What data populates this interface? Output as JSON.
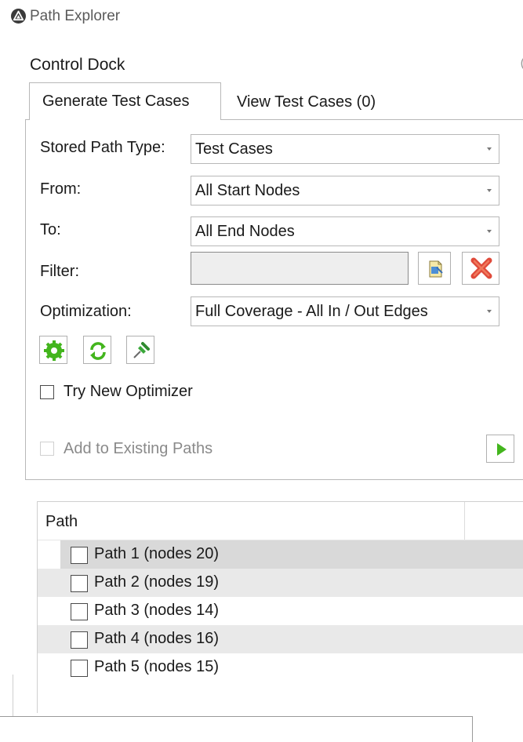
{
  "window": {
    "title": "Path Explorer",
    "icon": "app-logo-icon"
  },
  "dock": {
    "title": "Control Dock"
  },
  "tabs": [
    {
      "label": "Generate Test Cases",
      "active": true
    },
    {
      "label": "View Test Cases (0)",
      "active": false
    }
  ],
  "form": {
    "stored_path_type": {
      "label": "Stored Path Type:",
      "value": "Test Cases"
    },
    "from": {
      "label": "From:",
      "value": "All Start Nodes"
    },
    "to": {
      "label": "To:",
      "value": "All End Nodes"
    },
    "filter": {
      "label": "Filter:",
      "value": ""
    },
    "optimization": {
      "label": "Optimization:",
      "value": "Full Coverage - All In / Out Edges"
    },
    "try_new_optimizer": {
      "label": "Try New Optimizer",
      "checked": false
    },
    "add_to_existing": {
      "label": "Add to Existing Paths",
      "checked": false,
      "enabled": false
    }
  },
  "toolbar": {
    "buttons": [
      {
        "name": "generate-button",
        "icon": "gear-icon"
      },
      {
        "name": "refresh-button",
        "icon": "refresh-icon"
      },
      {
        "name": "pin-button",
        "icon": "pin-icon"
      }
    ]
  },
  "colors": {
    "accent_green": "#43b51d",
    "delete_red": "#e04a3a",
    "alt_row": "#e9e9e9",
    "selected_row": "#d9d9d9"
  },
  "grid": {
    "header": "Path",
    "rows": [
      {
        "label": "Path 1 (nodes 20)",
        "checked": false
      },
      {
        "label": "Path 2 (nodes 19)",
        "checked": false
      },
      {
        "label": "Path 3 (nodes 14)",
        "checked": false
      },
      {
        "label": "Path 4 (nodes 16)",
        "checked": false
      },
      {
        "label": "Path 5 (nodes 15)",
        "checked": false
      }
    ]
  }
}
